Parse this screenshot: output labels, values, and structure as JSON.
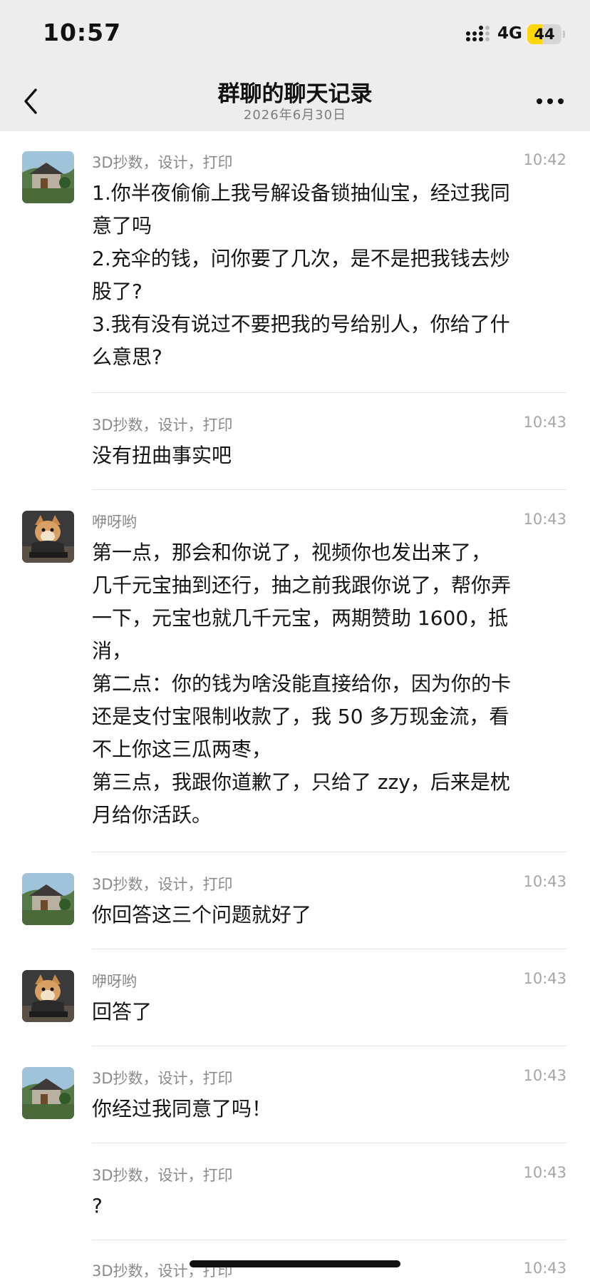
{
  "status_bar": {
    "time": "10:57",
    "network": "4G",
    "battery": "44",
    "battery_level": 0.44
  },
  "header": {
    "title": "群聊的聊天记录",
    "subtitle": "2026年6月30日",
    "back_icon": "chevron-left-icon",
    "more_icon": "more-horizontal-icon"
  },
  "messages": [
    {
      "sender": "3D抄数，设计，打印",
      "time": "10:42",
      "avatar": "landscape",
      "lines": [
        "1.你半夜偷偷上我号解设备锁抽仙宝，经过我同",
        "意了吗",
        "2.充伞的钱，问你要了几次，是不是把我钱去炒",
        "股了?",
        "3.我有没有说过不要把我的号给别人，你给了什",
        "么意思?"
      ]
    },
    {
      "sender": "3D抄数，设计，打印",
      "time": "10:43",
      "lines": [
        "没有扭曲事实吧"
      ]
    },
    {
      "sender": "咿呀哟",
      "time": "10:43",
      "avatar": "dog",
      "lines": [
        "第一点，那会和你说了，视频你也发出来了，",
        "几千元宝抽到还行，抽之前我跟你说了，帮你弄",
        "一下，元宝也就几千元宝，两期赞助 1600，抵",
        "消，",
        "第二点：你的钱为啥没能直接给你，因为你的卡",
        "还是支付宝限制收款了，我 50 多万现金流，看",
        "不上你这三瓜两枣，",
        "第三点，我跟你道歉了，只给了 zzy，后来是枕",
        "月给你活跃。"
      ]
    },
    {
      "sender": "3D抄数，设计，打印",
      "time": "10:43",
      "avatar": "landscape",
      "lines": [
        "你回答这三个问题就好了"
      ]
    },
    {
      "sender": "咿呀哟",
      "time": "10:43",
      "avatar": "dog",
      "lines": [
        "回答了"
      ]
    },
    {
      "sender": "3D抄数，设计，打印",
      "time": "10:43",
      "avatar": "landscape",
      "lines": [
        "你经过我同意了吗！"
      ]
    },
    {
      "sender": "3D抄数，设计，打印",
      "time": "10:43",
      "lines": [
        "?"
      ]
    },
    {
      "sender": "3D抄数，设计，打印",
      "time": "10:43",
      "lines": []
    }
  ]
}
